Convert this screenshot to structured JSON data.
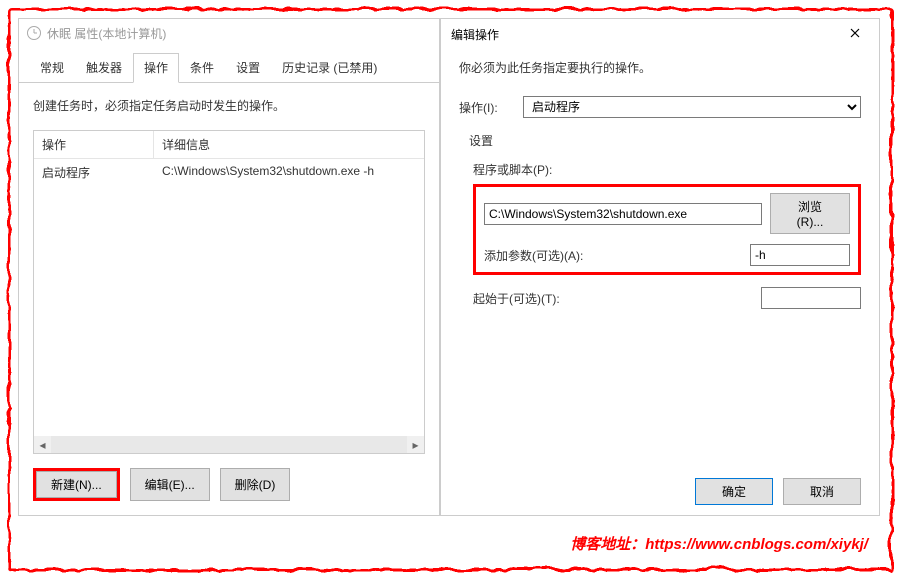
{
  "leftDialog": {
    "title": "休眠 属性(本地计算机)",
    "tabs": [
      "常规",
      "触发器",
      "操作",
      "条件",
      "设置",
      "历史记录 (已禁用)"
    ],
    "activeTab": 2,
    "hint": "创建任务时，必须指定任务启动时发生的操作。",
    "columns": [
      "操作",
      "详细信息"
    ],
    "rows": [
      {
        "action": "启动程序",
        "detail": "C:\\Windows\\System32\\shutdown.exe -h"
      }
    ],
    "buttons": {
      "new": "新建(N)...",
      "edit": "编辑(E)...",
      "delete": "删除(D)"
    }
  },
  "rightDialog": {
    "title": "编辑操作",
    "instruction": "你必须为此任务指定要执行的操作。",
    "actionLabel": "操作(I):",
    "actionValue": "启动程序",
    "settingsLabel": "设置",
    "programLabel": "程序或脚本(P):",
    "programValue": "C:\\Windows\\System32\\shutdown.exe",
    "browse": "浏览(R)...",
    "argsLabel": "添加参数(可选)(A):",
    "argsValue": "-h",
    "startInLabel": "起始于(可选)(T):",
    "startInValue": "",
    "ok": "确定",
    "cancel": "取消"
  },
  "blogUrl": "博客地址：https://www.cnblogs.com/xiykj/"
}
